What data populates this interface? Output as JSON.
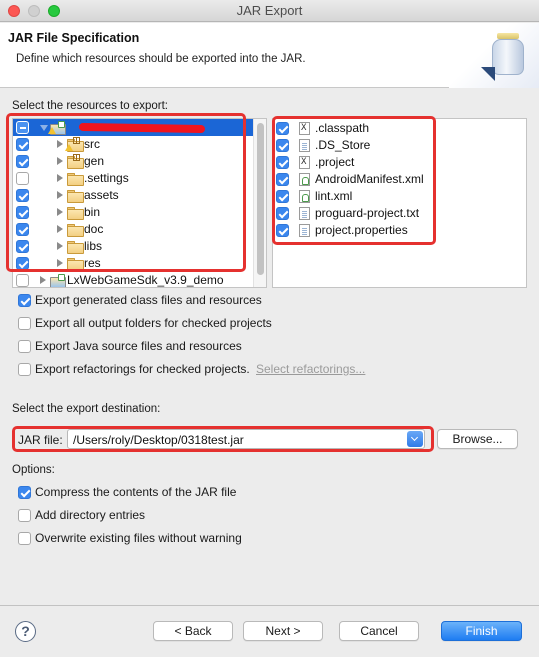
{
  "window": {
    "title": "JAR Export"
  },
  "banner": {
    "title": "JAR File Specification",
    "description": "Define which resources should be exported into the JAR.",
    "icon": "jar-icon"
  },
  "resources": {
    "label": "Select the resources to export:",
    "tree": [
      {
        "label": "[redacted project name]",
        "state": "mixed",
        "expanded": true,
        "selected": true,
        "level": 0,
        "icon": "android-project-icon",
        "warning": true
      },
      {
        "label": "src",
        "state": "checked",
        "level": 1,
        "icon": "package-folder-icon",
        "warning": true
      },
      {
        "label": "gen",
        "state": "checked",
        "level": 1,
        "icon": "package-folder-icon",
        "warning": false
      },
      {
        "label": ".settings",
        "state": "unchecked",
        "level": 1,
        "icon": "folder-icon"
      },
      {
        "label": "assets",
        "state": "checked",
        "level": 1,
        "icon": "folder-icon"
      },
      {
        "label": "bin",
        "state": "checked",
        "level": 1,
        "icon": "folder-icon"
      },
      {
        "label": "doc",
        "state": "checked",
        "level": 1,
        "icon": "folder-icon"
      },
      {
        "label": "libs",
        "state": "checked",
        "level": 1,
        "icon": "folder-icon"
      },
      {
        "label": "res",
        "state": "checked",
        "level": 1,
        "icon": "folder-icon"
      },
      {
        "label": "LxWebGameSdk_v3.9_demo",
        "state": "unchecked",
        "expanded": false,
        "level": 0,
        "icon": "android-project-icon"
      }
    ],
    "files": [
      {
        "label": ".classpath",
        "checked": true,
        "icon": "xml-x-icon"
      },
      {
        "label": ".DS_Store",
        "checked": true,
        "icon": "text-file-icon"
      },
      {
        "label": ".project",
        "checked": true,
        "icon": "xml-x-icon"
      },
      {
        "label": "AndroidManifest.xml",
        "checked": true,
        "icon": "android-file-icon"
      },
      {
        "label": "lint.xml",
        "checked": true,
        "icon": "android-file-icon"
      },
      {
        "label": "proguard-project.txt",
        "checked": true,
        "icon": "text-file-icon"
      },
      {
        "label": "project.properties",
        "checked": true,
        "icon": "text-file-icon"
      }
    ]
  },
  "export_options": [
    {
      "label": "Export generated class files and resources",
      "checked": true
    },
    {
      "label": "Export all output folders for checked projects",
      "checked": false
    },
    {
      "label": "Export Java source files and resources",
      "checked": false
    },
    {
      "label": "Export refactorings for checked projects.",
      "checked": false,
      "link": "Select refactorings..."
    }
  ],
  "destination": {
    "label": "Select the export destination:",
    "field_label": "JAR file:",
    "value": "/Users/roly/Desktop/0318test.jar",
    "browse_label": "Browse..."
  },
  "options": {
    "label": "Options:",
    "items": [
      {
        "label": "Compress the contents of the JAR file",
        "checked": true
      },
      {
        "label": "Add directory entries",
        "checked": false
      },
      {
        "label": "Overwrite existing files without warning",
        "checked": false
      }
    ]
  },
  "footer": {
    "help_symbol": "?",
    "back_label": "< Back",
    "next_label": "Next >",
    "cancel_label": "Cancel",
    "finish_label": "Finish"
  },
  "colors": {
    "accent": "#1e7cf2",
    "selection": "#1b66d6",
    "highlight_annotation": "#e5312f"
  }
}
